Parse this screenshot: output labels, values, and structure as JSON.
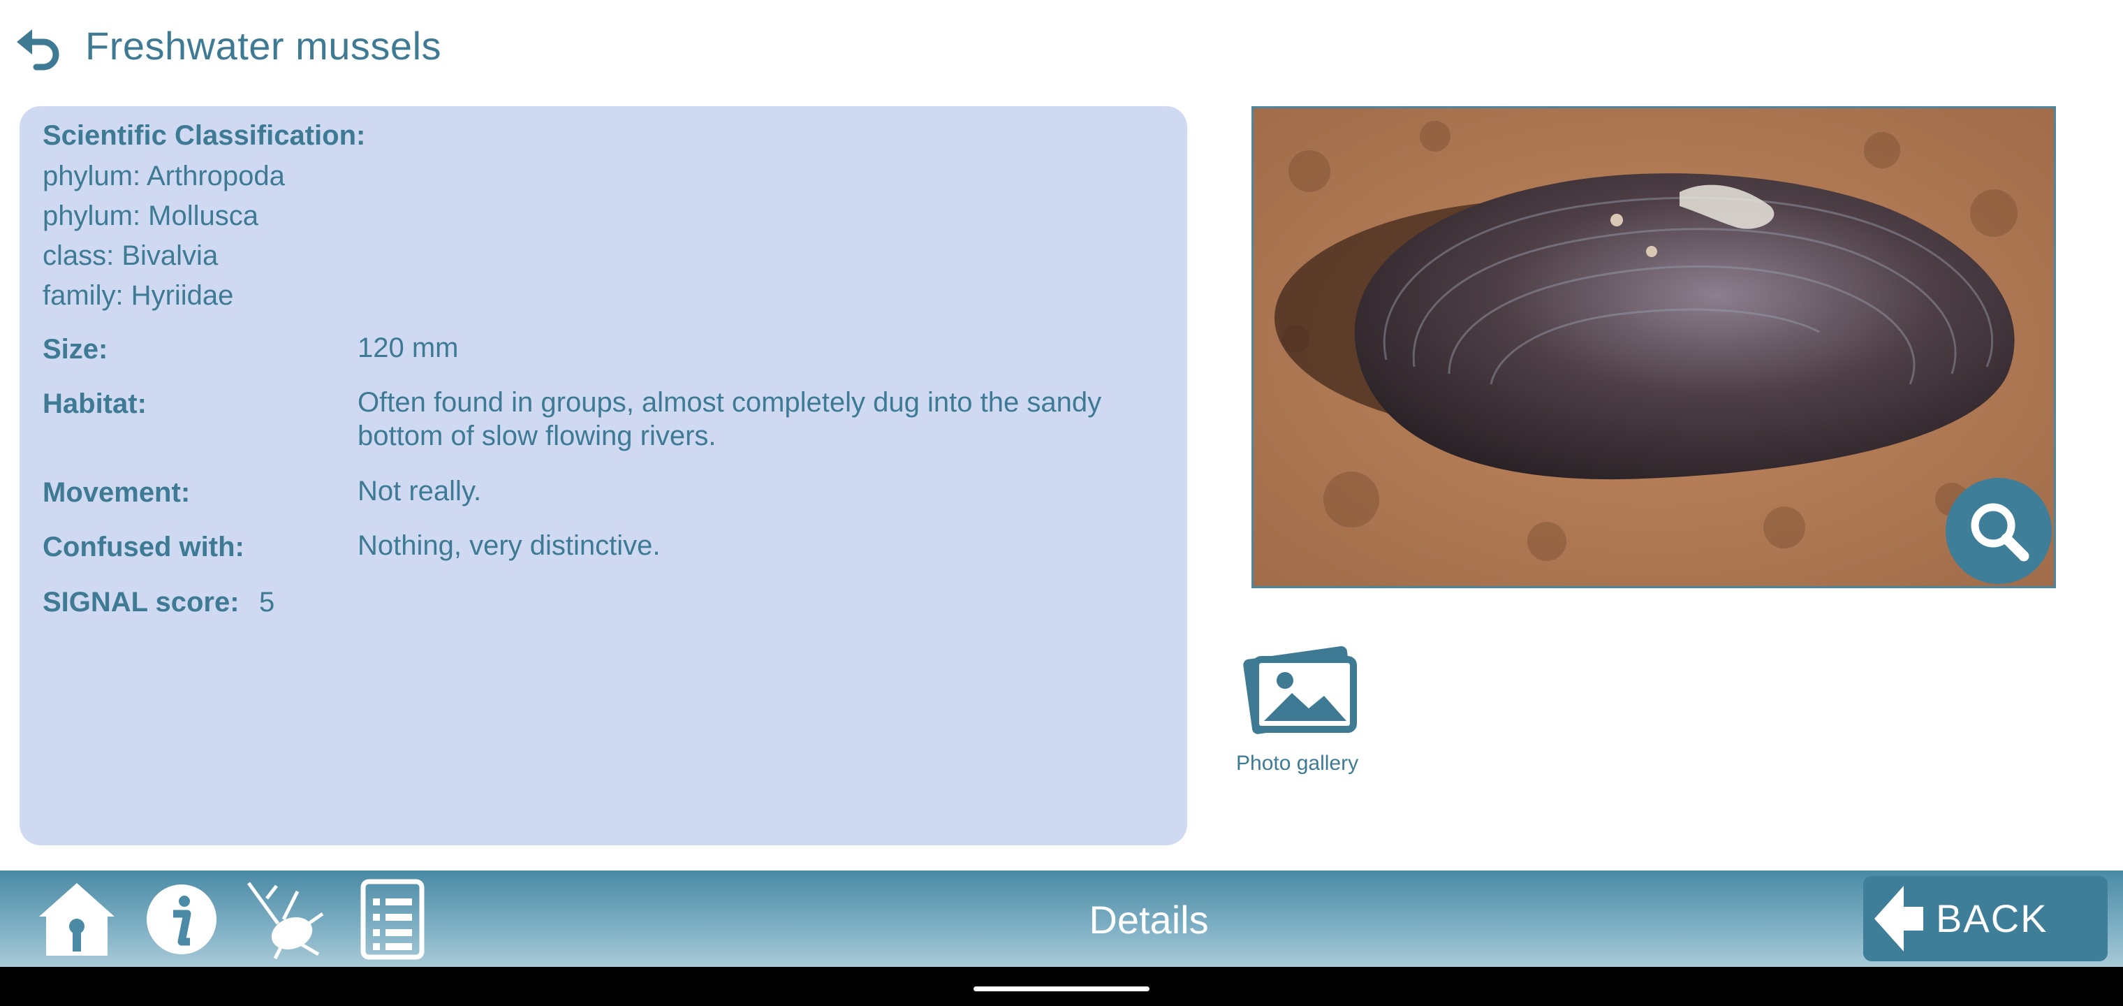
{
  "header": {
    "title": "Freshwater mussels",
    "back_icon": "undo-arrow-icon"
  },
  "details": {
    "classification_label": "Scientific Classification:",
    "classification_lines": [
      "phylum: Arthropoda",
      "phylum: Mollusca",
      "class: Bivalvia",
      "family: Hyriidae"
    ],
    "size_label": "Size:",
    "size_value": "120 mm",
    "habitat_label": "Habitat:",
    "habitat_value": "Often found in groups, almost completely dug into the sandy bottom of slow flowing rivers.",
    "movement_label": "Movement:",
    "movement_value": "Not really.",
    "confused_label": "Confused with:",
    "confused_value": "Nothing, very distinctive.",
    "signal_label": "SIGNAL score:",
    "signal_value": "5"
  },
  "media": {
    "gallery_label": "Photo gallery",
    "zoom_icon": "magnifier-icon",
    "gallery_icon": "photo-gallery-icon"
  },
  "bottombar": {
    "page_label": "Details",
    "back_label": "BACK",
    "icons": [
      "home-icon",
      "info-icon",
      "bug-icon",
      "list-icon"
    ]
  },
  "colors": {
    "accent": "#3e7a94",
    "panel": "#cfdaf2",
    "bar_top": "#4a8aa4",
    "bar_bottom": "#a9cad7"
  }
}
